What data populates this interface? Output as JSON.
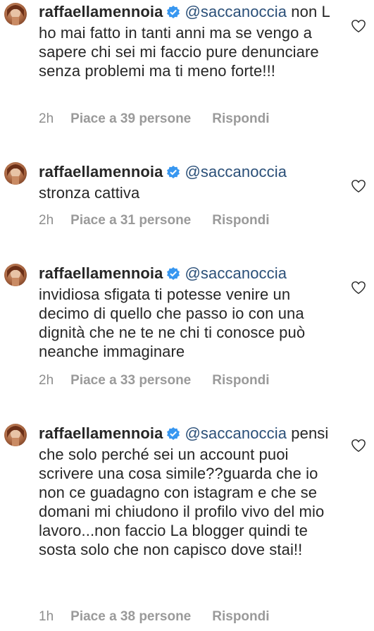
{
  "comments": [
    {
      "username": "raffaellamennoia",
      "mention": "@saccanoccia",
      "text": "non L ho mai fatto in tanti anni ma se vengo a sapere chi sei mi faccio pure denunciare senza problemi ma ti meno forte!!!",
      "time": "2h",
      "likes": "Piace a 39 persone",
      "reply": "Rispondi"
    },
    {
      "username": "raffaellamennoia",
      "mention": "@saccanoccia",
      "text": "stronza cattiva",
      "time": "2h",
      "likes": "Piace a 31 persone",
      "reply": "Rispondi"
    },
    {
      "username": "raffaellamennoia",
      "mention": "@saccanoccia",
      "text": "invidiosa sfigata ti potesse venire un decimo di quello che passo io con una dignità che ne te ne chi ti conosce può neanche immaginare",
      "time": "2h",
      "likes": "Piace a 33 persone",
      "reply": "Rispondi"
    },
    {
      "username": "raffaellamennoia",
      "mention": "@saccanoccia",
      "text": "pensi che solo perché sei un account puoi scrivere una cosa simile??guarda che io non ce guadagno con istagram e che se domani mi chiudono il profilo vivo del mio lavoro...non faccio La blogger quindi te sosta solo che non capisco dove stai!!",
      "time": "1h",
      "likes": "Piace a 38 persone",
      "reply": "Rispondi"
    }
  ],
  "colors": {
    "text": "#262626",
    "mention": "#2a4f78",
    "meta": "#8e8e8e",
    "verified": "#3897f0"
  }
}
